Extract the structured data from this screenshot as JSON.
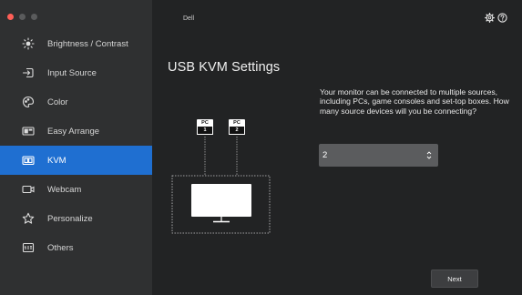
{
  "app": {
    "title": "Dell",
    "accent_color": "#1f6fd1"
  },
  "header": {
    "icons": [
      "gear-icon",
      "help-icon"
    ]
  },
  "sidebar": {
    "items": [
      {
        "label": "Brightness / Contrast",
        "icon": "brightness-icon",
        "active": false
      },
      {
        "label": "Input Source",
        "icon": "input-source-icon",
        "active": false
      },
      {
        "label": "Color",
        "icon": "color-palette-icon",
        "active": false
      },
      {
        "label": "Easy Arrange",
        "icon": "easy-arrange-icon",
        "active": false
      },
      {
        "label": "KVM",
        "icon": "kvm-icon",
        "active": true
      },
      {
        "label": "Webcam",
        "icon": "webcam-icon",
        "active": false
      },
      {
        "label": "Personalize",
        "icon": "star-icon",
        "active": false
      },
      {
        "label": "Others",
        "icon": "others-icon",
        "active": false
      }
    ]
  },
  "main": {
    "page_title": "USB KVM Settings",
    "description": "Your monitor can be connected to multiple sources, including PCs, game consoles and set-top boxes. How many source devices will you be connecting?",
    "source_count_select": {
      "value": "2"
    },
    "next_label": "Next",
    "diagram": {
      "pcs": [
        {
          "label": "PC",
          "number": "1"
        },
        {
          "label": "PC",
          "number": "2"
        }
      ]
    }
  }
}
